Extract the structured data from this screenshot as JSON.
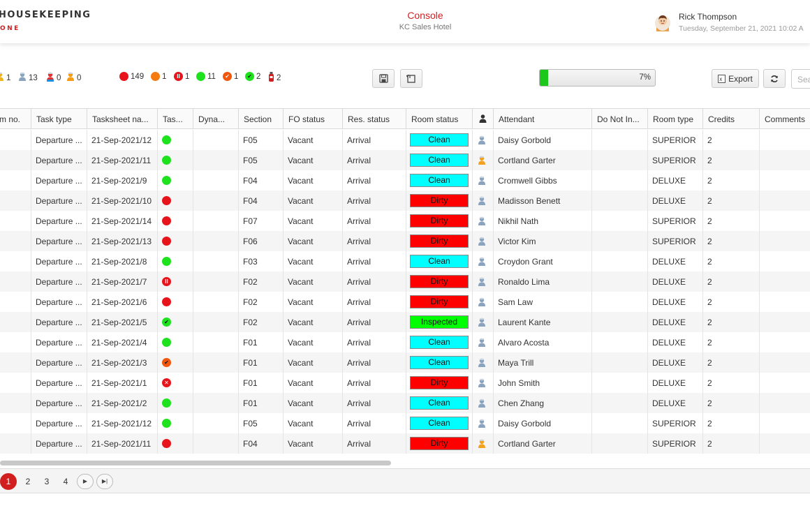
{
  "header": {
    "logo_top": "HOUSEKEEPING",
    "logo_bottom": "ONE",
    "title": "Console",
    "hotel": "KC Sales Hotel",
    "user_name": "Rick Thompson",
    "user_date": "Tuesday, September 21, 2021 10:02 A"
  },
  "toolbar": {
    "attendant_counters": [
      {
        "icon": "multi-person-icon",
        "value": "1"
      },
      {
        "icon": "person-blue-icon",
        "value": "13"
      },
      {
        "icon": "person-special-icon",
        "value": "0"
      },
      {
        "icon": "person-orange-icon",
        "value": "0"
      }
    ],
    "status_counters": [
      {
        "icon": "dirty-dot-icon",
        "color": "#e8141c",
        "mark": "",
        "value": "149"
      },
      {
        "icon": "in-progress-dot-icon",
        "color": "#f57a10",
        "mark": "",
        "value": "1"
      },
      {
        "icon": "paused-dot-icon",
        "color": "#e8141c",
        "mark": "II",
        "value": "1"
      },
      {
        "icon": "clean-dot-icon",
        "color": "#1ee21e",
        "mark": "",
        "value": "11"
      },
      {
        "icon": "checked-orange-dot-icon",
        "color": "#f0560e",
        "mark": "✔",
        "value": "1"
      },
      {
        "icon": "inspected-dot-icon",
        "color": "#1ee21e",
        "mark": "✔",
        "value": "2"
      },
      {
        "icon": "fire-extinguisher-icon",
        "color": "#d11f1f",
        "mark": "",
        "value": "2"
      }
    ],
    "progress_percent": 7,
    "progress_label": "7%",
    "export_label": "Export",
    "search_placeholder": "Sea"
  },
  "grid": {
    "columns": [
      "m no.",
      "Task type",
      "Tasksheet na...",
      "Tas...",
      "Dyna...",
      "Section",
      "FO status",
      "Res. status",
      "Room status",
      "",
      "Attendant",
      "Do Not In...",
      "Room type",
      "Credits",
      "Comments"
    ],
    "rows": [
      {
        "task_type": "Departure ...",
        "tasksheet": "21-Sep-2021/12",
        "task_status": "clean",
        "section": "F05",
        "fo": "Vacant",
        "res": "Arrival",
        "room_status": "Clean",
        "att_icon": "blue",
        "attendant": "Daisy Gorbold",
        "room_type": "SUPERIOR",
        "credits": "2"
      },
      {
        "task_type": "Departure ...",
        "tasksheet": "21-Sep-2021/11",
        "task_status": "clean",
        "section": "F05",
        "fo": "Vacant",
        "res": "Arrival",
        "room_status": "Clean",
        "att_icon": "orange",
        "attendant": "Cortland Garter",
        "room_type": "SUPERIOR",
        "credits": "2"
      },
      {
        "task_type": "Departure ...",
        "tasksheet": "21-Sep-2021/9",
        "task_status": "clean",
        "section": "F04",
        "fo": "Vacant",
        "res": "Arrival",
        "room_status": "Clean",
        "att_icon": "blue",
        "attendant": "Cromwell Gibbs",
        "room_type": "DELUXE",
        "credits": "2"
      },
      {
        "task_type": "Departure ...",
        "tasksheet": "21-Sep-2021/10",
        "task_status": "dirty",
        "section": "F04",
        "fo": "Vacant",
        "res": "Arrival",
        "room_status": "Dirty",
        "att_icon": "blue",
        "attendant": "Madisson Benett",
        "room_type": "DELUXE",
        "credits": "2"
      },
      {
        "task_type": "Departure ...",
        "tasksheet": "21-Sep-2021/14",
        "task_status": "dirty",
        "section": "F07",
        "fo": "Vacant",
        "res": "Arrival",
        "room_status": "Dirty",
        "att_icon": "blue",
        "attendant": "Nikhil Nath",
        "room_type": "SUPERIOR",
        "credits": "2"
      },
      {
        "task_type": "Departure ...",
        "tasksheet": "21-Sep-2021/13",
        "task_status": "dirty",
        "section": "F06",
        "fo": "Vacant",
        "res": "Arrival",
        "room_status": "Dirty",
        "att_icon": "blue",
        "attendant": "Victor Kim",
        "room_type": "SUPERIOR",
        "credits": "2"
      },
      {
        "task_type": "Departure ...",
        "tasksheet": "21-Sep-2021/8",
        "task_status": "clean",
        "section": "F03",
        "fo": "Vacant",
        "res": "Arrival",
        "room_status": "Clean",
        "att_icon": "blue",
        "attendant": "Croydon Grant",
        "room_type": "DELUXE",
        "credits": "2"
      },
      {
        "task_type": "Departure ...",
        "tasksheet": "21-Sep-2021/7",
        "task_status": "paused",
        "section": "F02",
        "fo": "Vacant",
        "res": "Arrival",
        "room_status": "Dirty",
        "att_icon": "blue",
        "attendant": "Ronaldo Lima",
        "room_type": "DELUXE",
        "credits": "2"
      },
      {
        "task_type": "Departure ...",
        "tasksheet": "21-Sep-2021/6",
        "task_status": "dirty",
        "section": "F02",
        "fo": "Vacant",
        "res": "Arrival",
        "room_status": "Dirty",
        "att_icon": "blue",
        "attendant": "Sam Law",
        "room_type": "DELUXE",
        "credits": "2"
      },
      {
        "task_type": "Departure ...",
        "tasksheet": "21-Sep-2021/5",
        "task_status": "inspected",
        "section": "F02",
        "fo": "Vacant",
        "res": "Arrival",
        "room_status": "Inspected",
        "att_icon": "blue",
        "attendant": "Laurent Kante",
        "room_type": "DELUXE",
        "credits": "2"
      },
      {
        "task_type": "Departure ...",
        "tasksheet": "21-Sep-2021/4",
        "task_status": "clean",
        "section": "F01",
        "fo": "Vacant",
        "res": "Arrival",
        "room_status": "Clean",
        "att_icon": "blue",
        "attendant": "Alvaro Acosta",
        "room_type": "DELUXE",
        "credits": "2"
      },
      {
        "task_type": "Departure ...",
        "tasksheet": "21-Sep-2021/3",
        "task_status": "checked",
        "section": "F01",
        "fo": "Vacant",
        "res": "Arrival",
        "room_status": "Clean",
        "att_icon": "blue",
        "attendant": "Maya Trill",
        "room_type": "DELUXE",
        "credits": "2"
      },
      {
        "task_type": "Departure ...",
        "tasksheet": "21-Sep-2021/1",
        "task_status": "rejected",
        "section": "F01",
        "fo": "Vacant",
        "res": "Arrival",
        "room_status": "Dirty",
        "att_icon": "blue",
        "attendant": "John Smith",
        "room_type": "DELUXE",
        "credits": "2"
      },
      {
        "task_type": "Departure ...",
        "tasksheet": "21-Sep-2021/2",
        "task_status": "clean",
        "section": "F01",
        "fo": "Vacant",
        "res": "Arrival",
        "room_status": "Clean",
        "att_icon": "blue",
        "attendant": "Chen Zhang",
        "room_type": "DELUXE",
        "credits": "2"
      },
      {
        "task_type": "Departure ...",
        "tasksheet": "21-Sep-2021/12",
        "task_status": "clean",
        "section": "F05",
        "fo": "Vacant",
        "res": "Arrival",
        "room_status": "Clean",
        "att_icon": "blue",
        "attendant": "Daisy Gorbold",
        "room_type": "SUPERIOR",
        "credits": "2"
      },
      {
        "task_type": "Departure ...",
        "tasksheet": "21-Sep-2021/11",
        "task_status": "dirty",
        "section": "F04",
        "fo": "Vacant",
        "res": "Arrival",
        "room_status": "Dirty",
        "att_icon": "orange",
        "attendant": "Cortland Garter",
        "room_type": "SUPERIOR",
        "credits": "2"
      }
    ]
  },
  "status_colors": {
    "clean": "#1ee21e",
    "dirty": "#e8141c",
    "badge_clean": "#00ffff",
    "badge_dirty": "#ff0000",
    "badge_inspected": "#00ff00",
    "accent": "#d11f1f"
  },
  "pagination": {
    "pages": [
      "1",
      "2",
      "3",
      "4"
    ],
    "active": "1"
  }
}
